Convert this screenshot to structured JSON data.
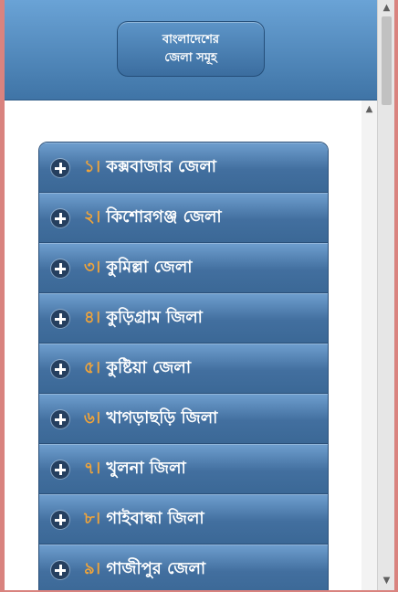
{
  "header": {
    "title_line1": "বাংলাদেশের",
    "title_line2": "জেলা সমূহ"
  },
  "list": {
    "items": [
      {
        "num": "১।",
        "label": "কক্সবাজার জেলা"
      },
      {
        "num": "২।",
        "label": "কিশোরগঞ্জ জেলা"
      },
      {
        "num": "৩।",
        "label": "কুমিল্লা জেলা"
      },
      {
        "num": "৪।",
        "label": "কুড়িগ্রাম জিলা"
      },
      {
        "num": "৫।",
        "label": "কুষ্টিয়া জেলা"
      },
      {
        "num": "৬।",
        "label": "খাগড়াছড়ি জিলা"
      },
      {
        "num": "৭।",
        "label": "খুলনা জিলা"
      },
      {
        "num": "৮।",
        "label": "গাইবান্ধা জিলা"
      },
      {
        "num": "৯।",
        "label": "গাজীপুর জেলা"
      }
    ]
  },
  "icons": {
    "expand": "plus-circle-icon",
    "scroll_up": "chevron-up-icon",
    "scroll_down": "chevron-down-icon"
  },
  "colors": {
    "header_top": "#6aa3d6",
    "header_bottom": "#3f74a6",
    "number_accent": "#f0a43a",
    "window_border": "#d9837f"
  }
}
